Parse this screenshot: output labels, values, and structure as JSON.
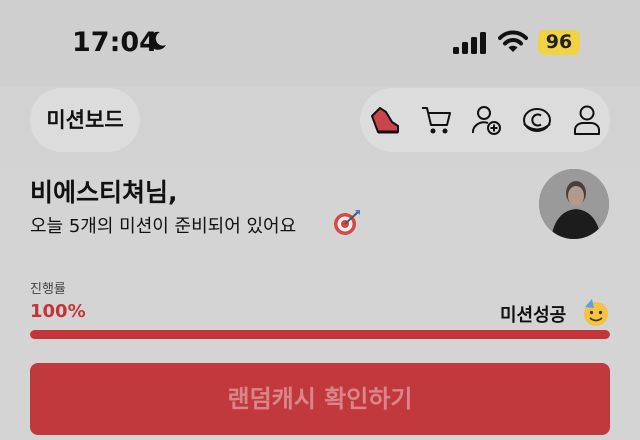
{
  "status_bar": {
    "time": "17:04",
    "battery": "96",
    "battery_color": "#f2d245",
    "icons": [
      "moon-icon",
      "signal-bars-icon",
      "wifi-icon"
    ]
  },
  "nav": {
    "brand": "미션보드",
    "icons": [
      "running-shoe-icon",
      "cart-icon",
      "add-user-icon",
      "coin-icon",
      "profile-icon"
    ]
  },
  "greeting": {
    "name_line": "비에스티쳐님,",
    "subtitle": "오늘 5개의 미션이 준비되어 있어요",
    "subtitle_emoji": "dart-target-icon"
  },
  "progress": {
    "label": "진행률",
    "value": "100%",
    "fraction": 1.0,
    "status": "미션성공",
    "status_emoji": "party-face-icon",
    "accent": "#c33538"
  },
  "cta": {
    "label": "랜덤캐시 확인하기",
    "color": "#c1393c"
  }
}
